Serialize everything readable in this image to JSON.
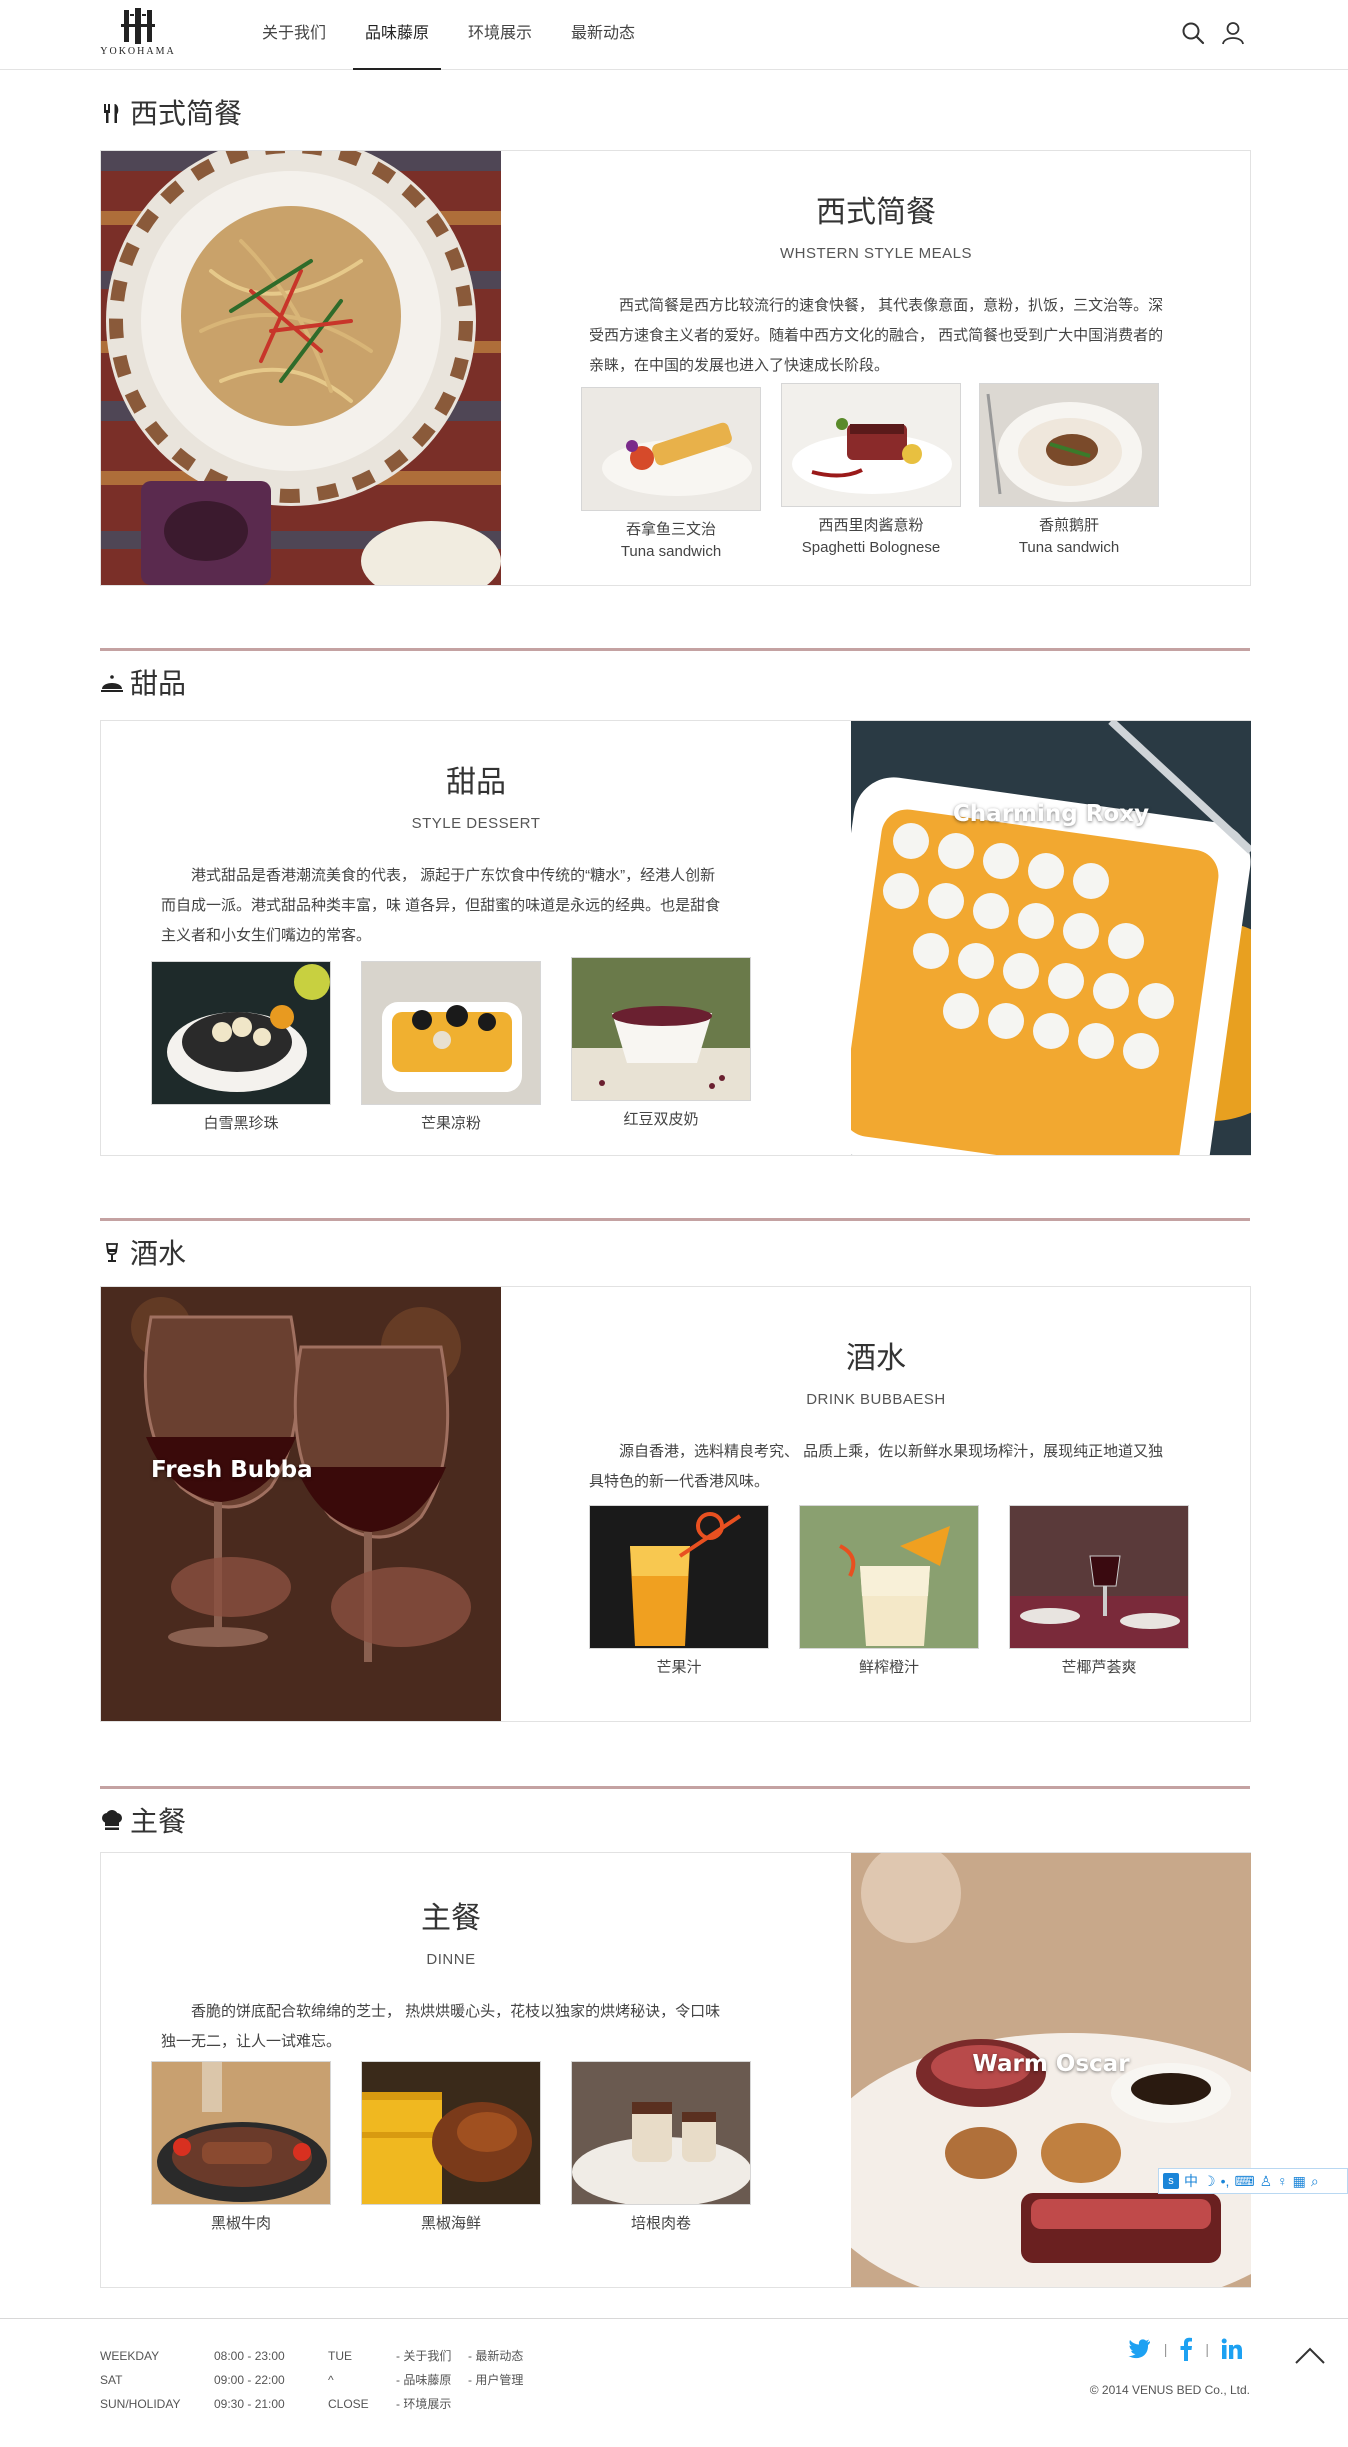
{
  "header": {
    "logo_text": "YOKOHAMA",
    "nav": [
      {
        "label": "关于我们",
        "active": false
      },
      {
        "label": "品味藤原",
        "active": true
      },
      {
        "label": "环境展示",
        "active": false
      },
      {
        "label": "最新动态",
        "active": false
      }
    ],
    "icons": [
      "search-icon",
      "user-icon"
    ]
  },
  "sections": [
    {
      "title": "西式简餐",
      "icon": "fork-knife-icon",
      "content_title": "西式简餐",
      "content_subtitle": "WHSTERN STYLE MEALS",
      "description": "西式简餐是西方比较流行的速食快餐， 其代表像意面，意粉，扒饭，三文治等。深受西方速食主义者的爱好。随着中西方文化的融合， 西式简餐也受到广大中国消费者的亲睐，在中国的发展也进入了快速成长阶段。",
      "photo_label": "",
      "items": [
        {
          "name": "吞拿鱼三文治",
          "name_en": "Tuna sandwich"
        },
        {
          "name": "西西里肉酱意粉",
          "name_en": "Spaghetti Bolognese"
        },
        {
          "name": "香煎鹅肝",
          "name_en": "Tuna sandwich"
        }
      ]
    },
    {
      "title": "甜品",
      "icon": "cloche-icon",
      "content_title": "甜品",
      "content_subtitle": "STYLE DESSERT",
      "description": "港式甜品是香港潮流美食的代表， 源起于广东饮食中传统的“糖水”，经港人创新而自成一派。港式甜品种类丰富，味 道各异，但甜蜜的味道是永远的经典。也是甜食主义者和小女生们嘴边的常客。",
      "photo_label": "Charming Roxy",
      "items": [
        {
          "name": "白雪黑珍珠"
        },
        {
          "name": "芒果凉粉"
        },
        {
          "name": "红豆双皮奶"
        }
      ]
    },
    {
      "title": "酒水",
      "icon": "wine-glass-icon",
      "content_title": "酒水",
      "content_subtitle": "DRINK BUBBAESH",
      "description": "源自香港，选料精良考究、 品质上乘，佐以新鲜水果现场榨汁，展现纯正地道又独具特色的新一代香港风味。",
      "photo_label": "Fresh Bubba",
      "items": [
        {
          "name": "芒果汁"
        },
        {
          "name": "鲜榨橙汁"
        },
        {
          "name": "芒椰芦荟爽"
        }
      ]
    },
    {
      "title": "主餐",
      "icon": "chef-hat-icon",
      "content_title": "主餐",
      "content_subtitle": "DINNE",
      "description": "香脆的饼底配合软绵绵的芝士， 热烘烘暖心头，花枝以独家的烘烤秘诀，令口味独一无二，让人一试难忘。",
      "photo_label": "Warm Oscar",
      "items": [
        {
          "name": "黑椒牛肉"
        },
        {
          "name": "黑椒海鲜"
        },
        {
          "name": "培根肉卷"
        }
      ]
    }
  ],
  "footer": {
    "hours": [
      {
        "day": "WEEKDAY",
        "time": "08:00 - 23:00",
        "note": "TUE"
      },
      {
        "day": "SAT",
        "time": "09:00 - 22:00",
        "note": "^"
      },
      {
        "day": "SUN/HOLIDAY",
        "time": "09:30 - 21:00",
        "note": "CLOSE"
      }
    ],
    "links_col1": [
      "- 关于我们",
      "- 品味藤原",
      "- 环境展示"
    ],
    "links_col2": [
      "- 最新动态",
      "- 用户管理"
    ],
    "social": [
      "twitter-icon",
      "facebook-icon",
      "linkedin-icon"
    ],
    "copyright": "© 2014 VENUS BED Co., Ltd."
  },
  "ime": {
    "label": "中"
  },
  "colors": {
    "divider": "#c4a2a2",
    "social_blue": "#1da1f2"
  }
}
